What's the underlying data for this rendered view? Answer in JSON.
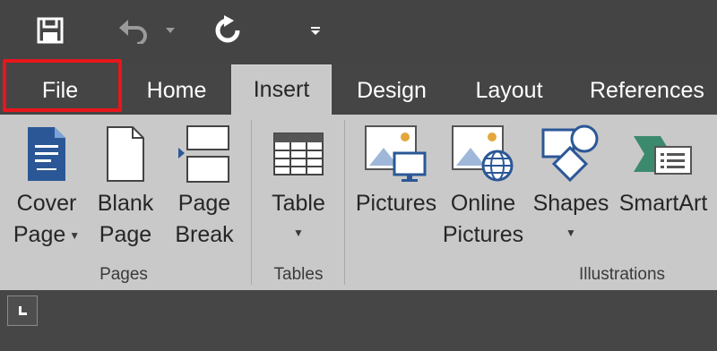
{
  "quick_access": {
    "save_icon": "save-icon",
    "undo_icon": "undo-icon",
    "redo_icon": "redo-icon",
    "customize_icon": "customize-qat-icon"
  },
  "tabs": {
    "file": "File",
    "home": "Home",
    "insert": "Insert",
    "design": "Design",
    "layout": "Layout",
    "references": "References",
    "active": "Insert"
  },
  "highlight_color": "#e8161c",
  "ribbon": {
    "pages": {
      "label": "Pages",
      "cover_page": {
        "line1": "Cover",
        "line2": "Page"
      },
      "blank_page": {
        "line1": "Blank",
        "line2": "Page"
      },
      "page_break": {
        "line1": "Page",
        "line2": "Break"
      }
    },
    "tables": {
      "label": "Tables",
      "table": {
        "line1": "Table"
      }
    },
    "illustrations": {
      "label": "Illustrations",
      "pictures": {
        "line1": "Pictures"
      },
      "online_pictures": {
        "line1": "Online",
        "line2": "Pictures"
      },
      "shapes": {
        "line1": "Shapes"
      },
      "smartart": {
        "line1": "SmartArt"
      }
    }
  },
  "colors": {
    "ribbon_bg": "#c9c9c9",
    "titlebar_bg": "#444444",
    "accent_blue": "#2b5797",
    "smartart_green": "#3c8a6e"
  }
}
